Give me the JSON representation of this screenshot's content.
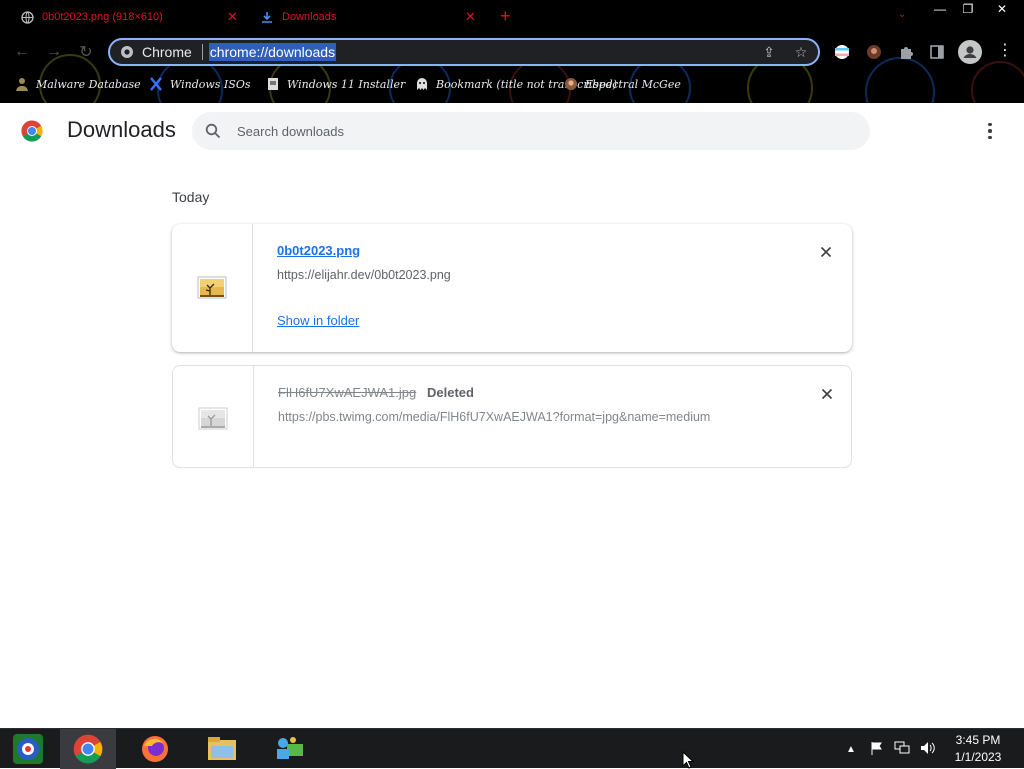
{
  "browser": {
    "tabs": [
      {
        "title": "0b0t2023.png (918×610)",
        "icon": "globe-icon",
        "active": false
      },
      {
        "title": "Downloads",
        "icon": "download-icon",
        "active": true
      }
    ],
    "new_tab_label": "+",
    "omnibox": {
      "site_label": "Chrome",
      "url": "chrome://downloads"
    },
    "bookmarks": [
      {
        "label": "Malware Database",
        "icon": "user-silhouette-icon"
      },
      {
        "label": "Windows ISOs",
        "icon": "x-logo-icon"
      },
      {
        "label": "Windows 11 Installer",
        "icon": "page-icon"
      },
      {
        "label": "Bookmark (title not transcribed)",
        "icon": "ghost-icon"
      },
      {
        "label": "Espectral McGee",
        "icon": "avatar-icon"
      }
    ],
    "theme_colors": {
      "tab_text": "#e0141c",
      "omnibox_border": "#8ab4f8",
      "selection": "#2f5fb8"
    }
  },
  "page": {
    "title": "Downloads",
    "search_placeholder": "Search downloads",
    "section_label": "Today",
    "downloads": [
      {
        "filename": "0b0t2023.png",
        "url": "https://elijahr.dev/0b0t2023.png",
        "action_label": "Show in folder",
        "status": ""
      },
      {
        "filename": "FlH6fU7XwAEJWA1.jpg",
        "url": "https://pbs.twimg.com/media/FlH6fU7XwAEJWA1?format=jpg&name=medium",
        "action_label": "",
        "status": "Deleted"
      }
    ]
  },
  "taskbar": {
    "apps": [
      "start-orb-icon",
      "chrome-icon",
      "firefox-icon",
      "file-explorer-icon",
      "network-people-icon"
    ],
    "time": "3:45 PM",
    "date": "1/1/2023"
  }
}
